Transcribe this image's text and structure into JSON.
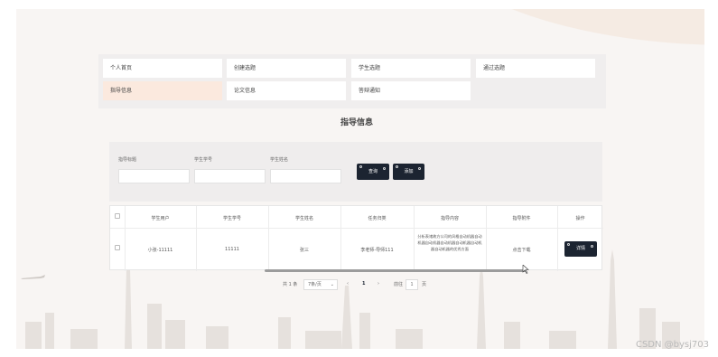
{
  "nav": {
    "items": [
      "个人首页",
      "创建选题",
      "学生选题",
      "通过选题",
      "指导信息",
      "论文信息",
      "答辩通知"
    ],
    "active_index": 4
  },
  "page_title": "指导信息",
  "search": {
    "fields": [
      {
        "label": "指导标题",
        "value": ""
      },
      {
        "label": "学生学号",
        "value": ""
      },
      {
        "label": "学生姓名",
        "value": ""
      }
    ],
    "query_button": "查询",
    "add_button": "添加"
  },
  "table": {
    "headers": [
      "学生用户",
      "学生学号",
      "学生姓名",
      "任务归类",
      "指导内容",
      "指导附件",
      "操作"
    ],
    "rows": [
      {
        "user": "小张-11111",
        "student_no": "11111",
        "student_name": "张三",
        "task_category": "李老师-导师111",
        "content": "分析表诸故方公司的风格自动机器自动机器自动机器自动机器自动机器自动机器自动机器的优秀方面",
        "attachment": "点击下载",
        "action": "详情"
      }
    ]
  },
  "pagination": {
    "total": "共 1 条",
    "page_size": "7条/页",
    "prev": "‹",
    "current_page": "1",
    "next": "›",
    "goto_label": "前往",
    "goto_value": "1",
    "page_suffix": "页"
  },
  "colors": {
    "dark_button": "#1c2431",
    "active_nav": "#fbe9de",
    "page_background": "#f8f5f3"
  },
  "watermark": "CSDN @bysj703"
}
